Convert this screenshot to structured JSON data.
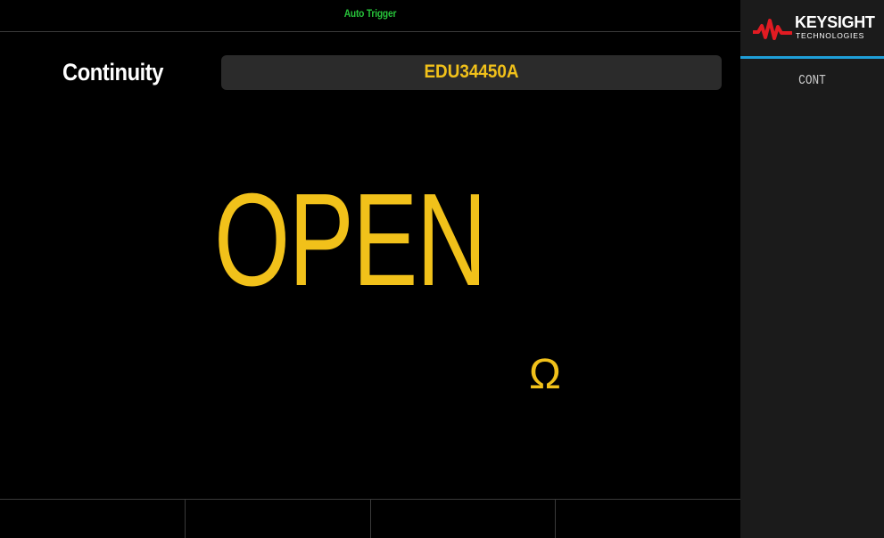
{
  "status": {
    "trigger": "Auto Trigger"
  },
  "measurement": {
    "function": "Continuity",
    "model": "EDU34450A",
    "reading": "OPEN",
    "unit": "Ω"
  },
  "brand": {
    "name": "KEYSIGHT",
    "subtitle": "TECHNOLOGIES",
    "icon": "keysight-wave-logo",
    "color": "#e11b22"
  },
  "side_menu": {
    "items": [
      {
        "label": "CONT"
      }
    ]
  },
  "softkeys": [
    {
      "label": ""
    },
    {
      "label": ""
    },
    {
      "label": ""
    },
    {
      "label": ""
    }
  ],
  "colors": {
    "reading": "#f1c11a",
    "status": "#27c43a",
    "accent": "#1f9fd9",
    "background": "#000000",
    "panel": "#1b1b1b"
  }
}
